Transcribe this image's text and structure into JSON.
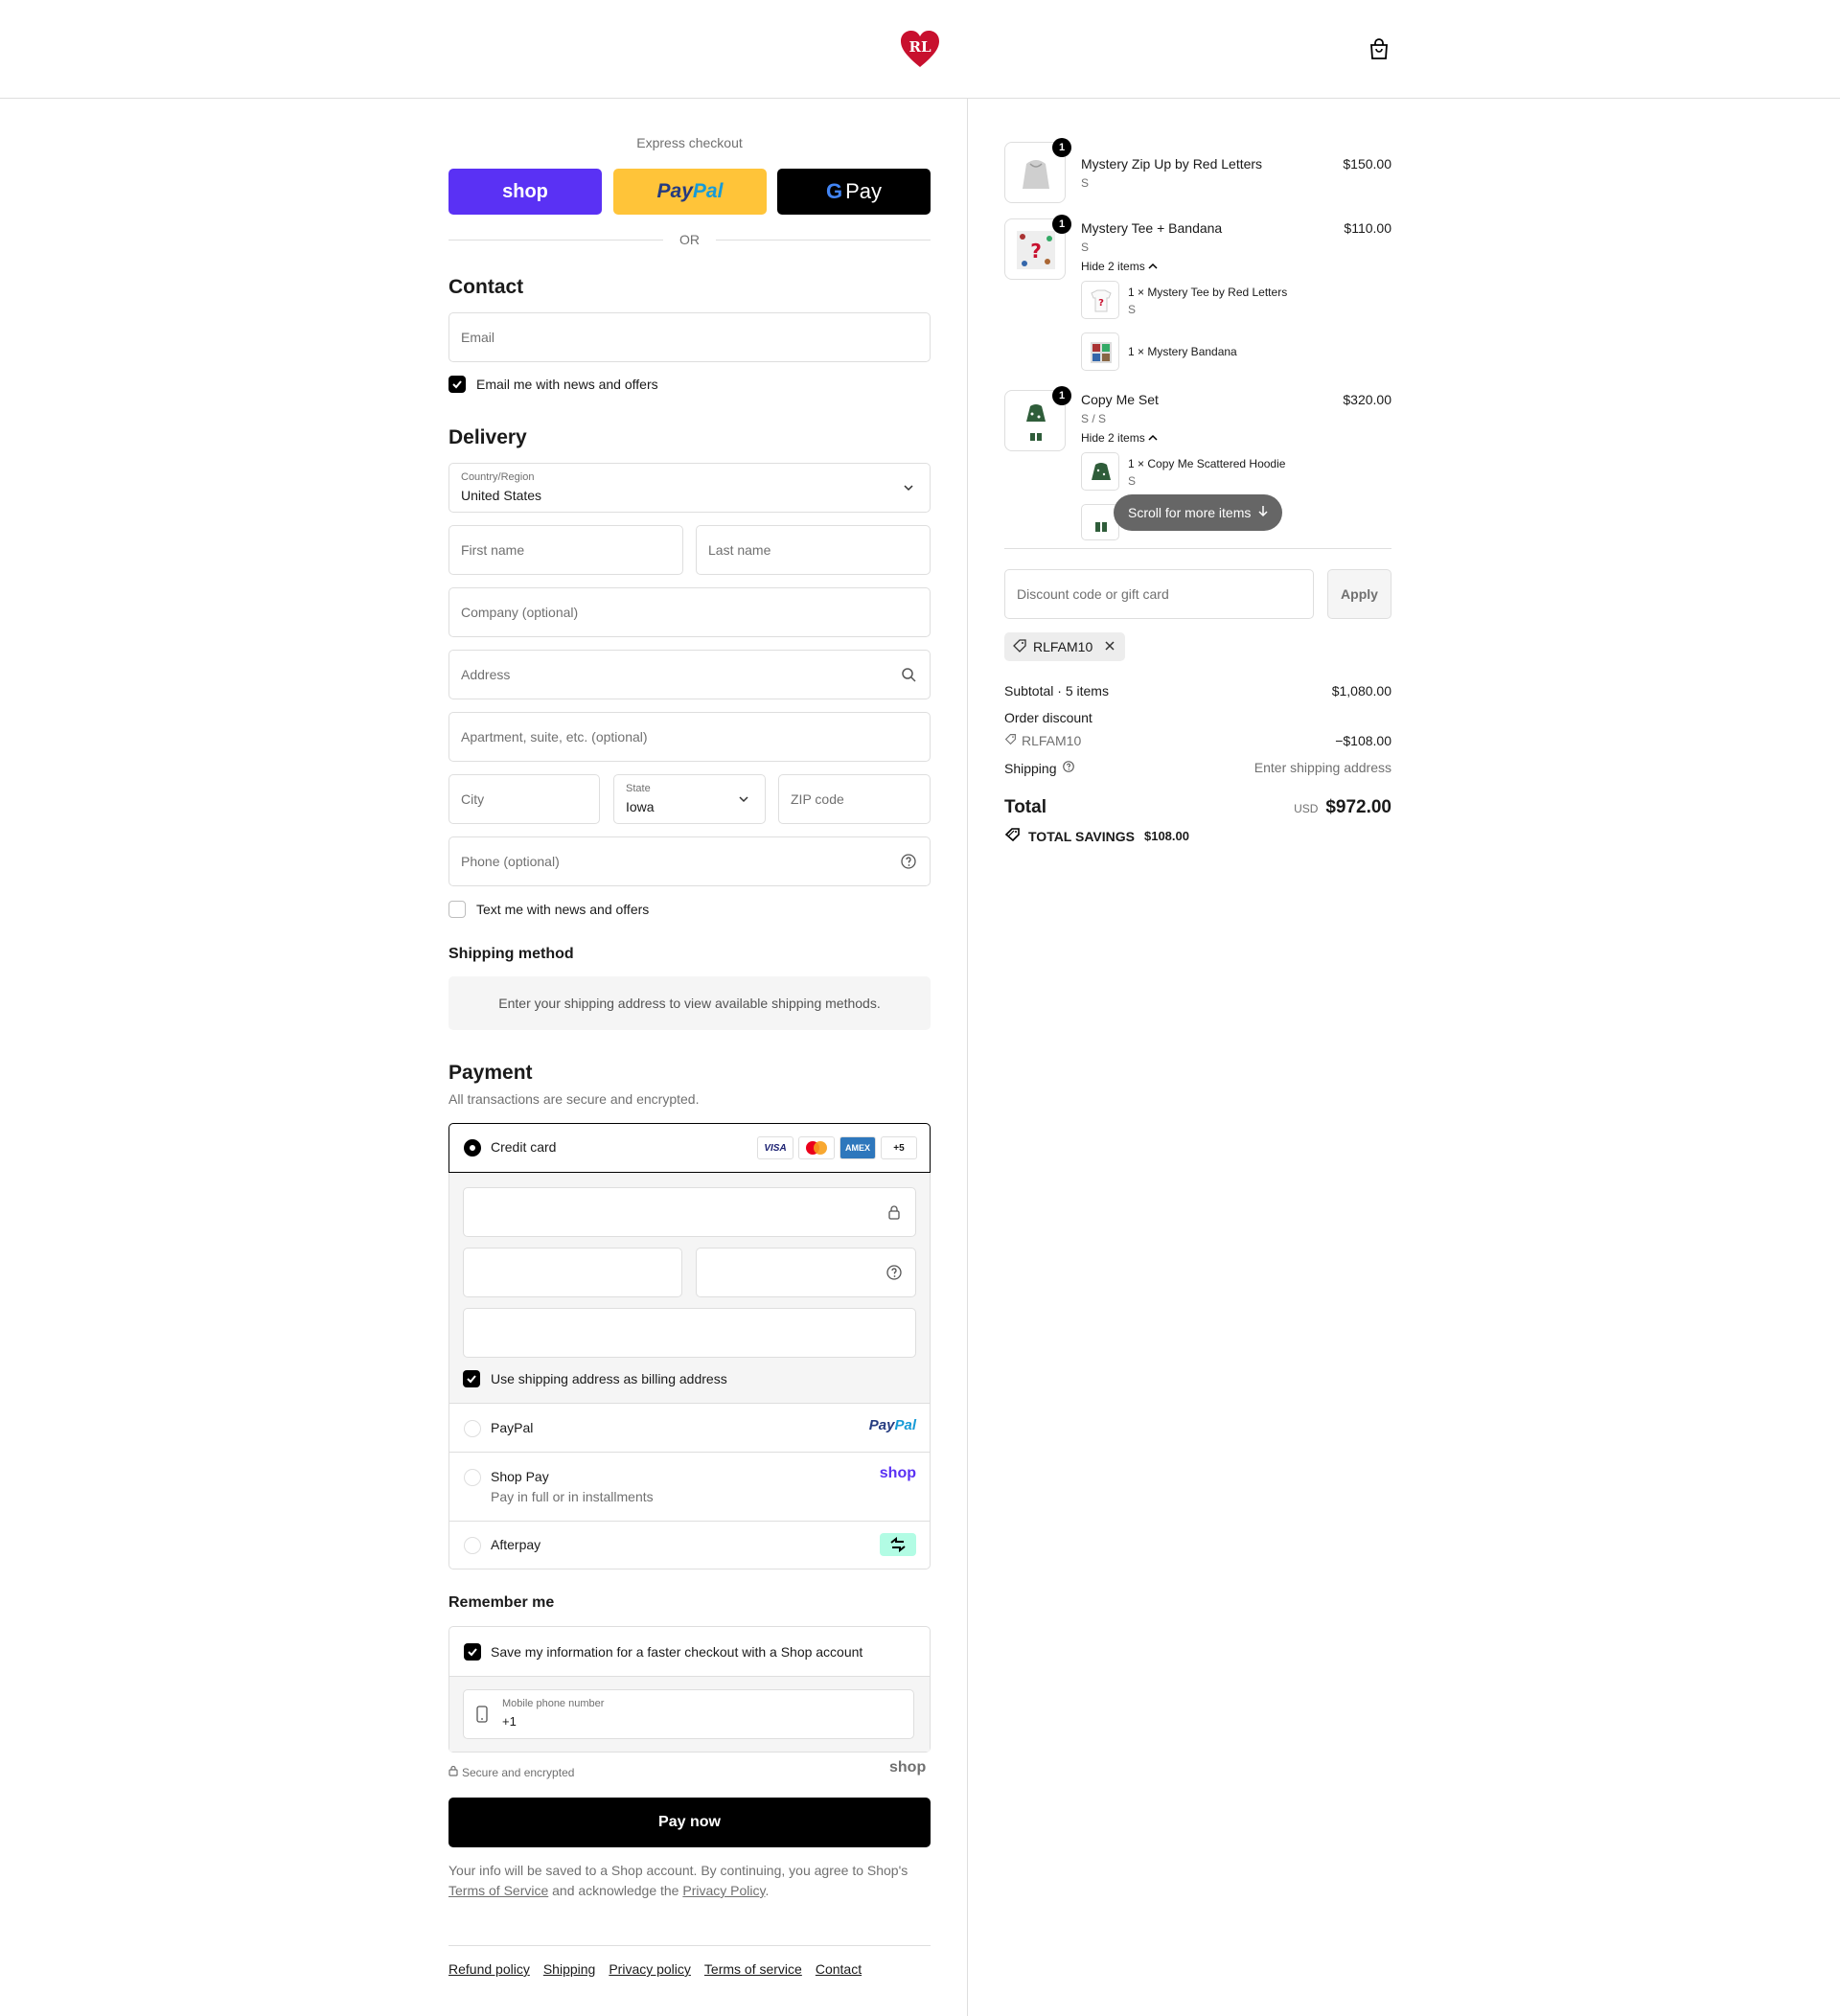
{
  "header": {
    "logo_text": "RL",
    "cart_icon": "shopping-bag-icon",
    "brand_color": "#c8102e"
  },
  "express": {
    "label": "Express checkout",
    "shop_label": "shop",
    "paypal_pay": "Pay",
    "paypal_pal": "Pal",
    "gpay_label": "Pay",
    "or_label": "OR",
    "shop_color": "#5a31f4",
    "paypal_color": "#ffc439"
  },
  "contact": {
    "title": "Contact",
    "email_placeholder": "Email",
    "newsletter_label": "Email me with news and offers",
    "newsletter_checked": true
  },
  "delivery": {
    "title": "Delivery",
    "country_label": "Country/Region",
    "country_value": "United States",
    "first_name_placeholder": "First name",
    "last_name_placeholder": "Last name",
    "company_placeholder": "Company (optional)",
    "address_placeholder": "Address",
    "apartment_placeholder": "Apartment, suite, etc. (optional)",
    "city_placeholder": "City",
    "state_label": "State",
    "state_value": "Iowa",
    "zip_placeholder": "ZIP code",
    "phone_placeholder": "Phone (optional)",
    "text_offers_label": "Text me with news and offers",
    "text_offers_checked": false
  },
  "shipping_method": {
    "title": "Shipping method",
    "note": "Enter your shipping address to view available shipping methods."
  },
  "payment": {
    "title": "Payment",
    "subtitle": "All transactions are secure and encrypted.",
    "credit_card_label": "Credit card",
    "card_brands": [
      "VISA",
      "",
      "AMEX"
    ],
    "more_cards": "+5",
    "billing_same_label": "Use shipping address as billing address",
    "billing_same_checked": true,
    "paypal_label": "PayPal",
    "paypal_logo_pay": "Pay",
    "paypal_logo_pal": "Pal",
    "shoppay_label": "Shop Pay",
    "shoppay_sub": "Pay in full or in installments",
    "shoppay_logo": "shop",
    "afterpay_label": "Afterpay",
    "afterpay_color": "#b2fce4"
  },
  "remember": {
    "title": "Remember me",
    "save_label": "Save my information for a faster checkout with a Shop account",
    "save_checked": true,
    "mobile_label": "Mobile phone number",
    "mobile_value": "+1",
    "secure_label": "Secure and encrypted",
    "shop_logo": "shop"
  },
  "pay_now_label": "Pay now",
  "legal": {
    "text1": "Your info will be saved to a Shop account. By continuing, you agree to Shop's",
    "terms_link": "Terms of Service",
    "text2": "and acknowledge the",
    "privacy_link": "Privacy Policy",
    "text3": "."
  },
  "footer_links": [
    "Refund policy",
    "Shipping",
    "Privacy policy",
    "Terms of service",
    "Contact"
  ],
  "order": {
    "items": [
      {
        "qty": "1",
        "name": "Mystery Zip Up by Red Letters",
        "variant": "S",
        "price": "$150.00"
      },
      {
        "qty": "1",
        "name": "Mystery Tee + Bandana",
        "variant": "S",
        "price": "$110.00",
        "toggle": "Hide 2 items",
        "sub_items": [
          {
            "name": "1 × Mystery Tee by Red Letters",
            "variant": "S"
          },
          {
            "name": "1 × Mystery Bandana",
            "variant": ""
          }
        ]
      },
      {
        "qty": "1",
        "name": "Copy Me Set",
        "variant": "S / S",
        "price": "$320.00",
        "toggle": "Hide 2 items",
        "sub_items": [
          {
            "name": "1 × Copy Me Scattered Hoodie",
            "variant": "S"
          }
        ]
      }
    ],
    "scroll_hint": "Scroll for more items",
    "discount_placeholder": "Discount code or gift card",
    "apply_label": "Apply",
    "applied_code": "RLFAM10",
    "subtotal_label": "Subtotal · 5 items",
    "subtotal_value": "$1,080.00",
    "order_discount_label": "Order discount",
    "discount_code": "RLFAM10",
    "discount_value": "−$108.00",
    "shipping_label": "Shipping",
    "shipping_value": "Enter shipping address",
    "total_label": "Total",
    "currency": "USD",
    "total_value": "$972.00",
    "savings_label": "TOTAL SAVINGS",
    "savings_value": "$108.00"
  }
}
